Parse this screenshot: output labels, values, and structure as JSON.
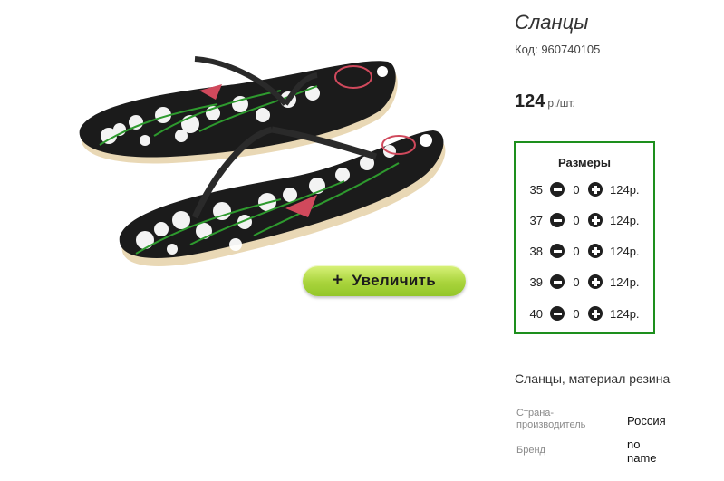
{
  "product": {
    "title": "Сланцы",
    "code": "Код: 960740105",
    "price_amount": "124",
    "price_unit": "р./шт.",
    "image_icon": "flip-flops-image",
    "zoom_button_label": "Увеличить",
    "description": "Сланцы, материал резина"
  },
  "sizes": {
    "title": "Размеры",
    "rows": [
      {
        "size": "35",
        "qty": "0",
        "price": "124р."
      },
      {
        "size": "37",
        "qty": "0",
        "price": "124р."
      },
      {
        "size": "38",
        "qty": "0",
        "price": "124р."
      },
      {
        "size": "39",
        "qty": "0",
        "price": "124р."
      },
      {
        "size": "40",
        "qty": "0",
        "price": "124р."
      }
    ]
  },
  "specs": [
    {
      "label": "Страна-производитель",
      "value": "Россия"
    },
    {
      "label": "Бренд",
      "value": "no name"
    }
  ],
  "colors": {
    "sizes_border": "#1d8f1d",
    "zoom_button": "#a9d43c"
  }
}
